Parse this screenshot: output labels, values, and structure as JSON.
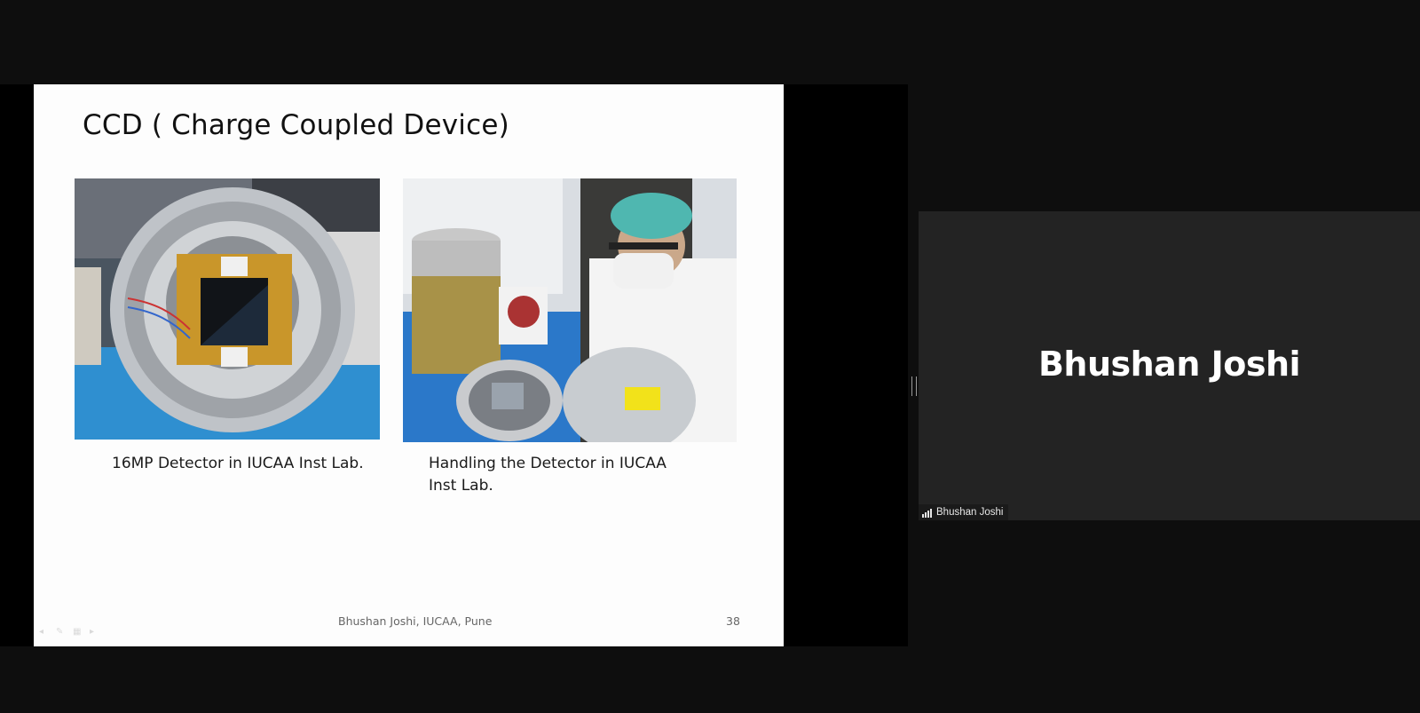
{
  "slide": {
    "title": "CCD ( Charge Coupled Device)",
    "images": [
      {
        "caption": "16MP Detector in IUCAA Inst Lab."
      },
      {
        "caption": "Handling the Detector in IUCAA Inst Lab."
      }
    ],
    "footer": "Bhushan Joshi, IUCAA, Pune",
    "page_number": "38"
  },
  "participant": {
    "display_name": "Bhushan Joshi",
    "label": "Bhushan Joshi"
  },
  "icons": {
    "signal": "signal-strength-icon"
  }
}
